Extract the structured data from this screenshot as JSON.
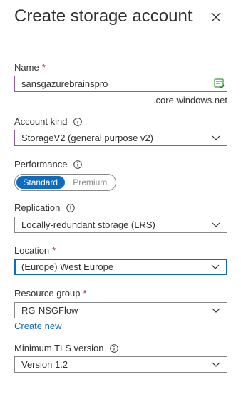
{
  "header": {
    "title": "Create storage account",
    "close_icon": "close-icon"
  },
  "fields": {
    "name": {
      "label": "Name",
      "required_mark": "*",
      "value": "sansgazurebrainspro",
      "suffix": ".core.windows.net"
    },
    "account_kind": {
      "label": "Account kind",
      "value": "StorageV2 (general purpose v2)"
    },
    "performance": {
      "label": "Performance",
      "options": [
        "Standard",
        "Premium"
      ],
      "selected": "Standard"
    },
    "replication": {
      "label": "Replication",
      "value": "Locally-redundant storage (LRS)"
    },
    "location": {
      "label": "Location",
      "required_mark": "*",
      "value": "(Europe) West Europe"
    },
    "resource_group": {
      "label": "Resource group",
      "required_mark": "*",
      "value": "RG-NSGFlow",
      "create_new": "Create new"
    },
    "tls": {
      "label": "Minimum TLS version",
      "value": "Version 1.2"
    }
  },
  "colors": {
    "accent": "#0f6cbd",
    "required": "#a4262c",
    "purple_border": "#8f5aa3"
  }
}
